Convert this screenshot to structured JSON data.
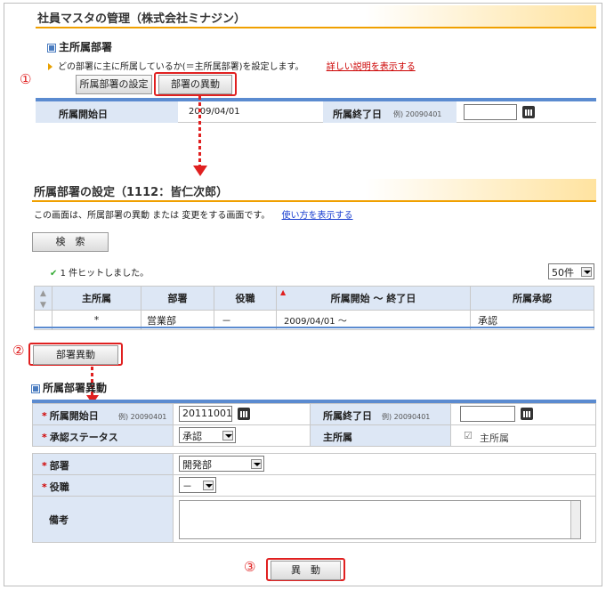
{
  "section1": {
    "title": "社員マスタの管理（株式会社ミナジン）",
    "subtitle": "主所属部署",
    "description": "どの部署に主に所属しているか(＝主所属部署)を設定します。",
    "detail_link": "詳しい説明を表示する",
    "step_label": "①",
    "btn_setting": "所属部署の設定",
    "btn_transfer": "部署の異動",
    "start_label": "所属開始日",
    "start_value": "2009/04/01",
    "end_label": "所属終了日",
    "end_example": "例) 20090401",
    "end_value": ""
  },
  "section2": {
    "title": "所属部署の設定（1112：皆仁次郎）",
    "description": "この画面は、所属部署の異動 または 変更をする画面です。",
    "usage_link": "使い方を表示する",
    "search_btn": "検　索",
    "hit_text": "1 件ヒットしました。",
    "page_size": "50件",
    "table": {
      "headers": [
        "主所属",
        "部署",
        "役職",
        "所属開始 ～ 終了日",
        "所属承認"
      ],
      "rows": [
        [
          "*",
          "営業部",
          "－",
          "2009/04/01 ～",
          "承認"
        ]
      ]
    }
  },
  "step2_label": "②",
  "transfer_btn": "部署異動",
  "form": {
    "subtitle": "所属部署異動",
    "start_label": "所属開始日",
    "start_example": "例) 20090401",
    "start_value": "20111001",
    "end_label": "所属終了日",
    "end_example": "例) 20090401",
    "end_value": "",
    "approval_label": "承認ステータス",
    "approval_value": "承認",
    "main_label": "主所属",
    "main_check_label": "主所属",
    "dept_label": "部署",
    "dept_value": "開発部",
    "role_label": "役職",
    "role_value": "－",
    "note_label": "備考",
    "note_value": ""
  },
  "step3_label": "③",
  "submit_btn": "異　動",
  "colors": {
    "accent": "#f0a000",
    "highlight": "#e02020",
    "band": "#5b8bd0",
    "label_bg": "#dde7f5"
  }
}
